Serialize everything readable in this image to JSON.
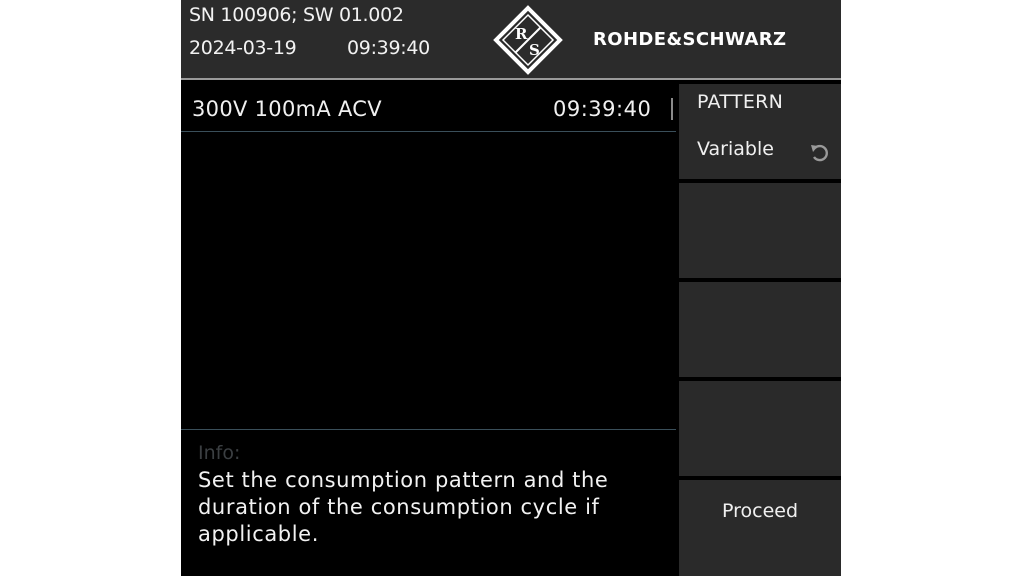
{
  "header": {
    "serial_sw": "SN 100906; SW 01.002",
    "date": "2024-03-19",
    "time": "09:39:40",
    "brand_text": "ROHDE&SCHWARZ",
    "brand_logo_letters": "R&S"
  },
  "status": {
    "range": "300V  100mA  ACV",
    "time": "09:39:40"
  },
  "info": {
    "label": "Info:",
    "text": "Set the consumption pattern and the duration of the consumption cycle if applicable."
  },
  "softkeys": [
    {
      "title": "PATTERN",
      "value": "Variable",
      "icon": "rotary-knob-icon"
    },
    {
      "label": ""
    },
    {
      "label": ""
    },
    {
      "label": ""
    },
    {
      "label": "Proceed"
    }
  ],
  "colors": {
    "header_bg": "#2b2b2b",
    "screen_bg": "#000000",
    "softkey_bg": "#2a2a2a",
    "text": "#f0f0f0",
    "divider": "#3a4f5a"
  }
}
